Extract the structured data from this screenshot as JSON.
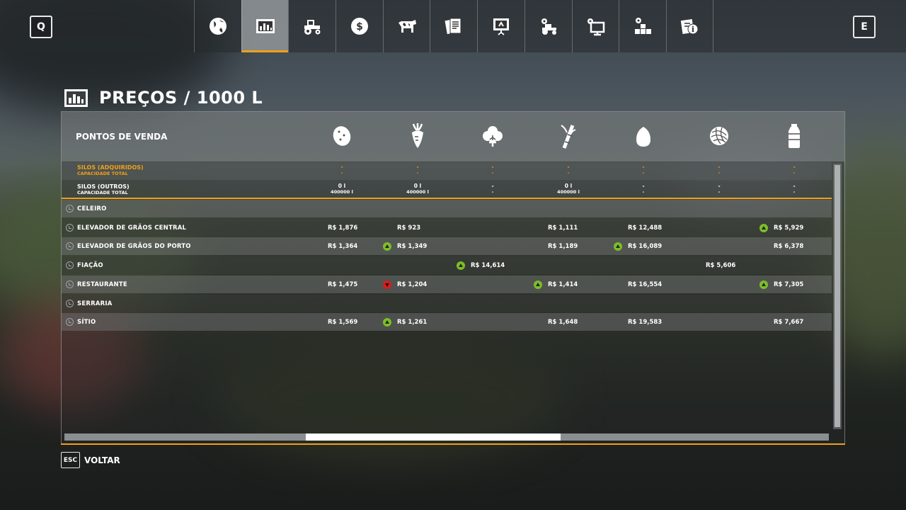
{
  "topbar": {
    "left_key": "Q",
    "right_key": "E",
    "tabs": [
      {
        "icon": "globe-icon",
        "active": false
      },
      {
        "icon": "prices-chart-icon",
        "active": true
      },
      {
        "icon": "tractor-icon",
        "active": false
      },
      {
        "icon": "money-icon",
        "active": false
      },
      {
        "icon": "cow-icon",
        "active": false
      },
      {
        "icon": "contracts-icon",
        "active": false
      },
      {
        "icon": "presentation-icon",
        "active": false
      },
      {
        "icon": "vehicle-settings-icon",
        "active": false
      },
      {
        "icon": "monitor-icon",
        "active": false
      },
      {
        "icon": "production-icon",
        "active": false
      },
      {
        "icon": "help-icon",
        "active": false
      }
    ]
  },
  "title": "PREÇOS / 1000 L",
  "table": {
    "header_label": "PONTOS DE VENDA",
    "columns": [
      "potato-icon",
      "sugarbeet-icon",
      "cotton-icon",
      "sugarcane-icon",
      "egg-icon",
      "wool-icon",
      "milk-icon"
    ],
    "silos_acquired": {
      "label": "SILOS (ADQUIRIDOS)",
      "sublabel": "CAPACIDADE TOTAL",
      "cells": [
        "-",
        "-",
        "-",
        "-",
        "-",
        "-",
        "-"
      ],
      "subcells": [
        "-",
        "-",
        "-",
        "-",
        "-",
        "-",
        "-"
      ]
    },
    "silos_other": {
      "label": "SILOS (OUTROS)",
      "sublabel": "CAPACIDADE TOTAL",
      "cells": [
        "0 l",
        "0 l",
        "-",
        "0 l",
        "-",
        "-",
        "-"
      ],
      "subcells": [
        "400000 l",
        "400000 l",
        "-",
        "400000 l",
        "-",
        "-",
        "-"
      ]
    },
    "rows": [
      {
        "label": "CELEIRO",
        "cells": [
          null,
          null,
          null,
          null,
          null,
          null,
          null
        ]
      },
      {
        "label": "ELEVADOR DE GRÃOS CENTRAL",
        "cells": [
          {
            "price": "R$ 1,876",
            "trend": ""
          },
          {
            "price": "R$ 923",
            "trend": ""
          },
          null,
          {
            "price": "R$ 1,111",
            "trend": ""
          },
          {
            "price": "R$ 12,488",
            "trend": ""
          },
          null,
          {
            "price": "R$ 5,929",
            "trend": "up"
          }
        ]
      },
      {
        "label": "ELEVADOR DE GRÃOS DO PORTO",
        "cells": [
          {
            "price": "R$ 1,364",
            "trend": ""
          },
          {
            "price": "R$ 1,349",
            "trend": "up"
          },
          null,
          {
            "price": "R$ 1,189",
            "trend": ""
          },
          {
            "price": "R$ 16,089",
            "trend": "up"
          },
          null,
          {
            "price": "R$ 6,378",
            "trend": ""
          }
        ]
      },
      {
        "label": "FIAÇÃO",
        "cells": [
          null,
          null,
          {
            "price": "R$ 14,614",
            "trend": "up"
          },
          null,
          null,
          {
            "price": "R$ 5,606",
            "trend": ""
          },
          null
        ]
      },
      {
        "label": "RESTAURANTE",
        "cells": [
          {
            "price": "R$ 1,475",
            "trend": ""
          },
          {
            "price": "R$ 1,204",
            "trend": "down"
          },
          null,
          {
            "price": "R$ 1,414",
            "trend": "up"
          },
          {
            "price": "R$ 16,554",
            "trend": ""
          },
          null,
          {
            "price": "R$ 7,305",
            "trend": "up"
          }
        ]
      },
      {
        "label": "SERRARIA",
        "cells": [
          null,
          null,
          null,
          null,
          null,
          null,
          null
        ]
      },
      {
        "label": "SÍTIO",
        "cells": [
          {
            "price": "R$ 1,569",
            "trend": ""
          },
          {
            "price": "R$ 1,261",
            "trend": "up"
          },
          null,
          {
            "price": "R$ 1,648",
            "trend": ""
          },
          {
            "price": "R$ 19,583",
            "trend": ""
          },
          null,
          {
            "price": "R$ 7,667",
            "trend": ""
          }
        ]
      }
    ]
  },
  "footer": {
    "key": "ESC",
    "label": "VOLTAR"
  },
  "colors": {
    "accent": "#f0a019",
    "trend_up": "#7ebd2a",
    "trend_down": "#d21e1e"
  }
}
